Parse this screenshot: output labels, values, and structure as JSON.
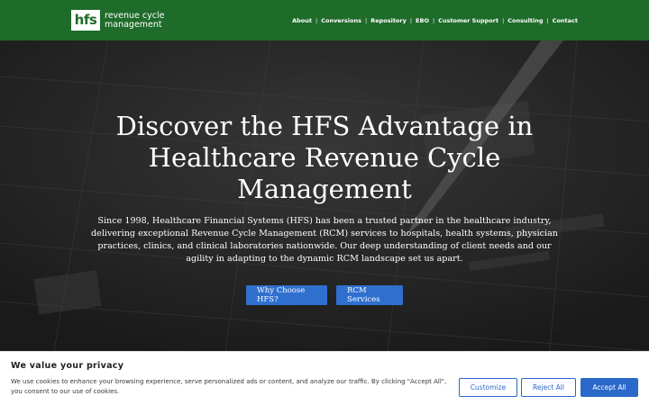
{
  "header": {
    "logo_mark": "hfs",
    "logo_line1": "revenue cycle",
    "logo_line2": "management",
    "nav": [
      {
        "label": "About"
      },
      {
        "label": "Conversions"
      },
      {
        "label": "Repository"
      },
      {
        "label": "EBO"
      },
      {
        "label": "Customer Support"
      },
      {
        "label": "Consulting"
      },
      {
        "label": "Contact"
      }
    ],
    "separator": "|"
  },
  "hero": {
    "title": "Discover the HFS Advantage in Healthcare Revenue Cycle Management",
    "text": "Since 1998, Healthcare Financial Systems (HFS) has been a trusted partner in the healthcare industry, delivering exceptional Revenue Cycle Management (RCM) services to hospitals, health systems, physician practices, clinics, and clinical laboratories nationwide. Our deep understanding of client needs and our agility in adapting to the dynamic RCM landscape set us apart.",
    "button_primary": "Why Choose HFS?",
    "button_secondary": "RCM Services"
  },
  "cookie": {
    "title": "We value your privacy",
    "text": "We use cookies to enhance your browsing experience, serve personalized ads or content, and analyze our traffic. By clicking \"Accept All\", you consent to our use of cookies.",
    "customize": "Customize",
    "reject": "Reject All",
    "accept": "Accept All"
  },
  "colors": {
    "header_green": "#1f6b2a",
    "button_blue": "#2f6fce",
    "cookie_blue": "#2a68c9"
  }
}
